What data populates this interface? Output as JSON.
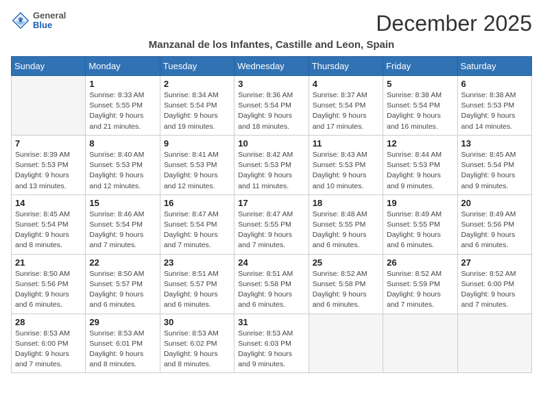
{
  "header": {
    "logo_general": "General",
    "logo_blue": "Blue",
    "month_title": "December 2025",
    "location": "Manzanal de los Infantes, Castille and Leon, Spain"
  },
  "days_of_week": [
    "Sunday",
    "Monday",
    "Tuesday",
    "Wednesday",
    "Thursday",
    "Friday",
    "Saturday"
  ],
  "weeks": [
    [
      {
        "day": "",
        "empty": true
      },
      {
        "day": "1",
        "sunrise": "Sunrise: 8:33 AM",
        "sunset": "Sunset: 5:55 PM",
        "daylight": "Daylight: 9 hours and 21 minutes."
      },
      {
        "day": "2",
        "sunrise": "Sunrise: 8:34 AM",
        "sunset": "Sunset: 5:54 PM",
        "daylight": "Daylight: 9 hours and 19 minutes."
      },
      {
        "day": "3",
        "sunrise": "Sunrise: 8:36 AM",
        "sunset": "Sunset: 5:54 PM",
        "daylight": "Daylight: 9 hours and 18 minutes."
      },
      {
        "day": "4",
        "sunrise": "Sunrise: 8:37 AM",
        "sunset": "Sunset: 5:54 PM",
        "daylight": "Daylight: 9 hours and 17 minutes."
      },
      {
        "day": "5",
        "sunrise": "Sunrise: 8:38 AM",
        "sunset": "Sunset: 5:54 PM",
        "daylight": "Daylight: 9 hours and 16 minutes."
      },
      {
        "day": "6",
        "sunrise": "Sunrise: 8:38 AM",
        "sunset": "Sunset: 5:53 PM",
        "daylight": "Daylight: 9 hours and 14 minutes."
      }
    ],
    [
      {
        "day": "7",
        "sunrise": "Sunrise: 8:39 AM",
        "sunset": "Sunset: 5:53 PM",
        "daylight": "Daylight: 9 hours and 13 minutes."
      },
      {
        "day": "8",
        "sunrise": "Sunrise: 8:40 AM",
        "sunset": "Sunset: 5:53 PM",
        "daylight": "Daylight: 9 hours and 12 minutes."
      },
      {
        "day": "9",
        "sunrise": "Sunrise: 8:41 AM",
        "sunset": "Sunset: 5:53 PM",
        "daylight": "Daylight: 9 hours and 12 minutes."
      },
      {
        "day": "10",
        "sunrise": "Sunrise: 8:42 AM",
        "sunset": "Sunset: 5:53 PM",
        "daylight": "Daylight: 9 hours and 11 minutes."
      },
      {
        "day": "11",
        "sunrise": "Sunrise: 8:43 AM",
        "sunset": "Sunset: 5:53 PM",
        "daylight": "Daylight: 9 hours and 10 minutes."
      },
      {
        "day": "12",
        "sunrise": "Sunrise: 8:44 AM",
        "sunset": "Sunset: 5:53 PM",
        "daylight": "Daylight: 9 hours and 9 minutes."
      },
      {
        "day": "13",
        "sunrise": "Sunrise: 8:45 AM",
        "sunset": "Sunset: 5:54 PM",
        "daylight": "Daylight: 9 hours and 9 minutes."
      }
    ],
    [
      {
        "day": "14",
        "sunrise": "Sunrise: 8:45 AM",
        "sunset": "Sunset: 5:54 PM",
        "daylight": "Daylight: 9 hours and 8 minutes."
      },
      {
        "day": "15",
        "sunrise": "Sunrise: 8:46 AM",
        "sunset": "Sunset: 5:54 PM",
        "daylight": "Daylight: 9 hours and 7 minutes."
      },
      {
        "day": "16",
        "sunrise": "Sunrise: 8:47 AM",
        "sunset": "Sunset: 5:54 PM",
        "daylight": "Daylight: 9 hours and 7 minutes."
      },
      {
        "day": "17",
        "sunrise": "Sunrise: 8:47 AM",
        "sunset": "Sunset: 5:55 PM",
        "daylight": "Daylight: 9 hours and 7 minutes."
      },
      {
        "day": "18",
        "sunrise": "Sunrise: 8:48 AM",
        "sunset": "Sunset: 5:55 PM",
        "daylight": "Daylight: 9 hours and 6 minutes."
      },
      {
        "day": "19",
        "sunrise": "Sunrise: 8:49 AM",
        "sunset": "Sunset: 5:55 PM",
        "daylight": "Daylight: 9 hours and 6 minutes."
      },
      {
        "day": "20",
        "sunrise": "Sunrise: 8:49 AM",
        "sunset": "Sunset: 5:56 PM",
        "daylight": "Daylight: 9 hours and 6 minutes."
      }
    ],
    [
      {
        "day": "21",
        "sunrise": "Sunrise: 8:50 AM",
        "sunset": "Sunset: 5:56 PM",
        "daylight": "Daylight: 9 hours and 6 minutes."
      },
      {
        "day": "22",
        "sunrise": "Sunrise: 8:50 AM",
        "sunset": "Sunset: 5:57 PM",
        "daylight": "Daylight: 9 hours and 6 minutes."
      },
      {
        "day": "23",
        "sunrise": "Sunrise: 8:51 AM",
        "sunset": "Sunset: 5:57 PM",
        "daylight": "Daylight: 9 hours and 6 minutes."
      },
      {
        "day": "24",
        "sunrise": "Sunrise: 8:51 AM",
        "sunset": "Sunset: 5:58 PM",
        "daylight": "Daylight: 9 hours and 6 minutes."
      },
      {
        "day": "25",
        "sunrise": "Sunrise: 8:52 AM",
        "sunset": "Sunset: 5:58 PM",
        "daylight": "Daylight: 9 hours and 6 minutes."
      },
      {
        "day": "26",
        "sunrise": "Sunrise: 8:52 AM",
        "sunset": "Sunset: 5:59 PM",
        "daylight": "Daylight: 9 hours and 7 minutes."
      },
      {
        "day": "27",
        "sunrise": "Sunrise: 8:52 AM",
        "sunset": "Sunset: 6:00 PM",
        "daylight": "Daylight: 9 hours and 7 minutes."
      }
    ],
    [
      {
        "day": "28",
        "sunrise": "Sunrise: 8:53 AM",
        "sunset": "Sunset: 6:00 PM",
        "daylight": "Daylight: 9 hours and 7 minutes."
      },
      {
        "day": "29",
        "sunrise": "Sunrise: 8:53 AM",
        "sunset": "Sunset: 6:01 PM",
        "daylight": "Daylight: 9 hours and 8 minutes."
      },
      {
        "day": "30",
        "sunrise": "Sunrise: 8:53 AM",
        "sunset": "Sunset: 6:02 PM",
        "daylight": "Daylight: 9 hours and 8 minutes."
      },
      {
        "day": "31",
        "sunrise": "Sunrise: 8:53 AM",
        "sunset": "Sunset: 6:03 PM",
        "daylight": "Daylight: 9 hours and 9 minutes."
      },
      {
        "day": "",
        "empty": true
      },
      {
        "day": "",
        "empty": true
      },
      {
        "day": "",
        "empty": true
      }
    ]
  ]
}
